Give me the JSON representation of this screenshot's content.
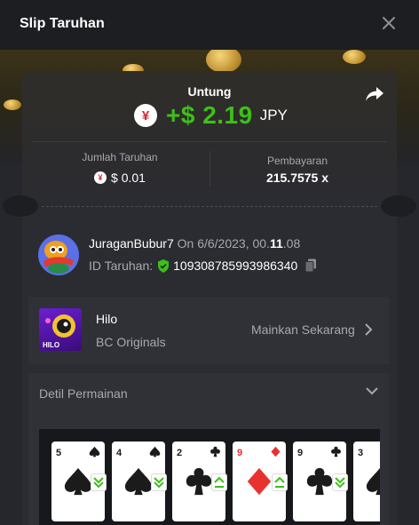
{
  "modal": {
    "title": "Slip Taruhan"
  },
  "profit": {
    "label": "Untung",
    "amount": "+$ 2.19",
    "currency": "JPY",
    "currency_symbol": "¥"
  },
  "stats": {
    "bet_label": "Jumlah Taruhan",
    "bet_value": "$ 0.01",
    "payout_label": "Pembayaran",
    "payout_value": "215.7575 x"
  },
  "bet_info": {
    "username": "JuraganBubur7",
    "on_date": " On 6/6/2023, 00.",
    "time_bold": "11",
    "time_rest": ".08",
    "id_label": "ID Taruhan:",
    "id_value": "109308785993986340"
  },
  "game": {
    "name": "Hilo",
    "provider": "BC Originals",
    "play_label": "Mainkan Sekarang",
    "thumb_label": "HILO"
  },
  "details": {
    "title": "Detil Permainan"
  },
  "cards": [
    {
      "rank": "5",
      "suit": "spade",
      "color": "black",
      "arrow": "down"
    },
    {
      "rank": "4",
      "suit": "spade",
      "color": "black",
      "arrow": "down"
    },
    {
      "rank": "2",
      "suit": "club",
      "color": "black",
      "arrow": "up"
    },
    {
      "rank": "9",
      "suit": "diamond",
      "color": "red",
      "arrow": "up"
    },
    {
      "rank": "9",
      "suit": "club",
      "color": "black",
      "arrow": "down"
    },
    {
      "rank": "3",
      "suit": "spade",
      "color": "black",
      "arrow": "none"
    }
  ],
  "colors": {
    "profit_green": "#3bc117",
    "accent_green": "#3bc117",
    "red": "#e8322f",
    "background": "#1d1e22"
  }
}
